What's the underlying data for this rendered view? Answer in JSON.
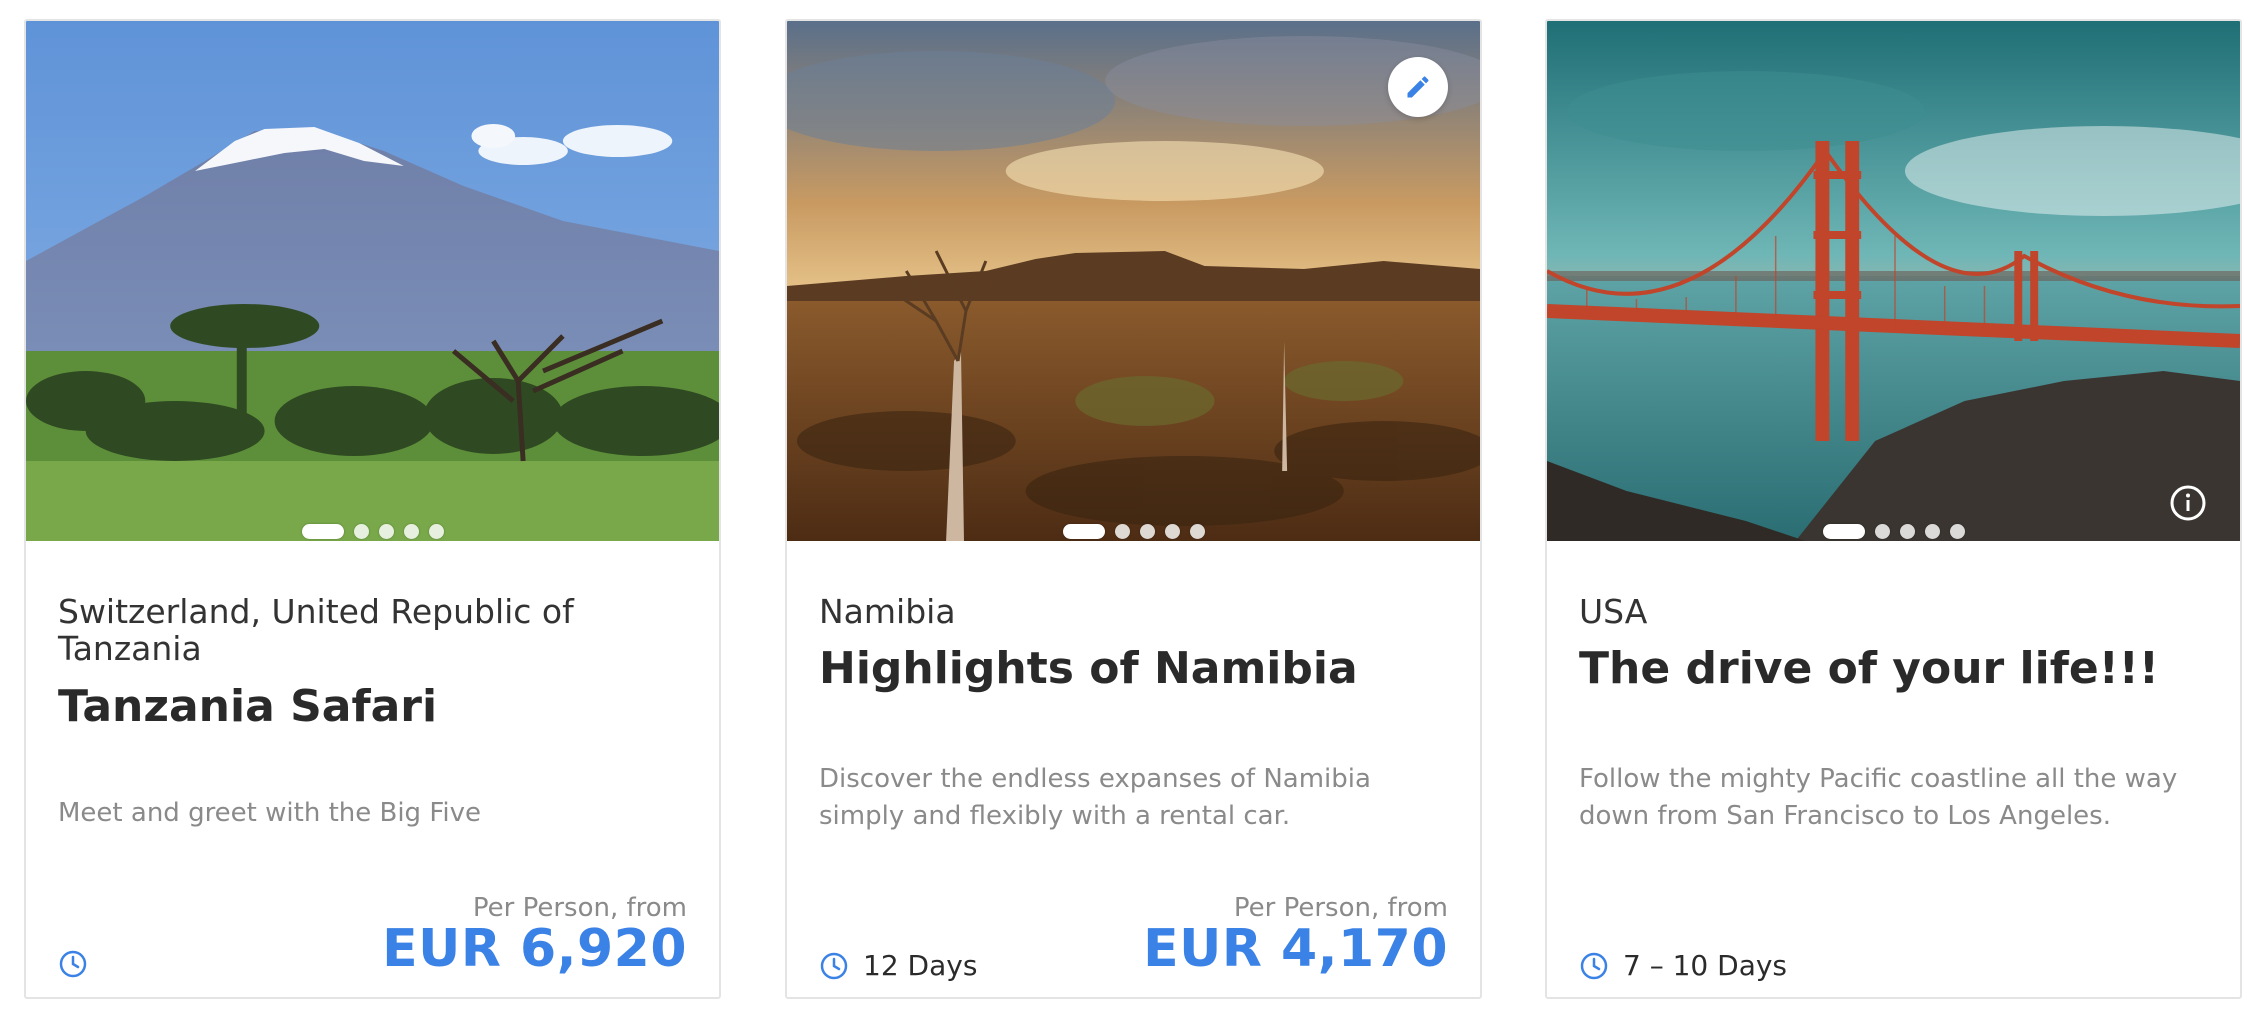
{
  "cards": [
    {
      "country": "Switzerland, United Republic of Tanzania",
      "title": "Tanzania Safari",
      "description": "Meet and greet with the Big Five",
      "price_label": "Per Person, from",
      "price": "EUR 6,920",
      "duration": "",
      "image_alt": "Mount Kilimanjaro with acacia trees",
      "carousel": {
        "slides": 5,
        "active": 1
      }
    },
    {
      "country": "Namibia",
      "title": "Highlights of Namibia",
      "description": "Discover the endless expanses of Namibia simply and flexibly with a rental car.",
      "price_label": "Per Person, from",
      "price": "EUR 4,170",
      "duration": "12 Days",
      "image_alt": "Namibian desert landscape at sunset",
      "carousel": {
        "slides": 5,
        "active": 1
      },
      "action_icon": "pencil-icon"
    },
    {
      "country": "USA",
      "title": "The drive of your life!!!",
      "description": "Follow the mighty Pacific coastline all the way down from San Francisco to Los Angeles.",
      "price_label": "",
      "price": "",
      "duration": "7 – 10 Days",
      "image_alt": "Golden Gate Bridge",
      "carousel": {
        "slides": 5,
        "active": 1
      },
      "action_icon": "info-icon"
    }
  ],
  "colors": {
    "accent": "#3b82e6",
    "text": "#2b2b2b",
    "muted": "#8a8a8a",
    "border": "#e4e4e4"
  }
}
